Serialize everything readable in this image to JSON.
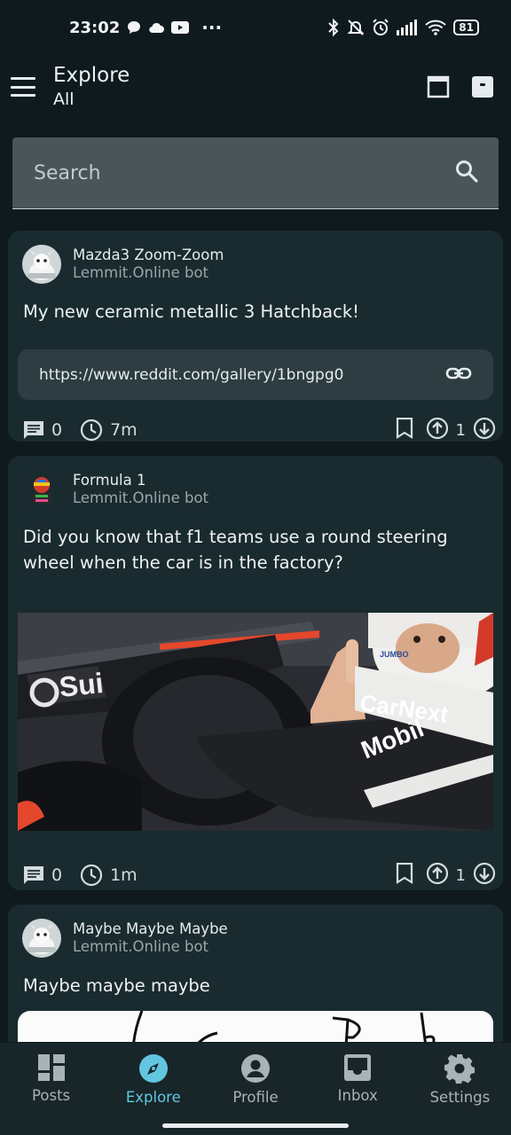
{
  "status": {
    "time": "23:02",
    "battery": "81",
    "more": "···"
  },
  "header": {
    "title": "Explore",
    "subtitle": "All"
  },
  "search": {
    "placeholder": "Search"
  },
  "posts": [
    {
      "community": "Mazda3 Zoom-Zoom",
      "author": "Lemmit.Online bot",
      "title": "My new ceramic metallic 3 Hatchback!",
      "link": "https://www.reddit.com/gallery/1bngpg0",
      "comments": "0",
      "age": "7m",
      "score": "1"
    },
    {
      "community": "Formula 1",
      "author": "Lemmit.Online bot",
      "title": "Did you know that f1 teams use a round steering wheel when the car is in the factory?",
      "comments": "0",
      "age": "1m",
      "score": "1",
      "image_text": {
        "sponsor": "Sui",
        "helmet": "CarNext",
        "side": "Mobil",
        "brand": "JUMBO"
      }
    },
    {
      "community": "Maybe Maybe Maybe",
      "author": "Lemmit.Online bot",
      "title": "Maybe maybe maybe"
    }
  ],
  "nav": [
    {
      "label": "Posts",
      "icon": "posts-icon"
    },
    {
      "label": "Explore",
      "icon": "compass-icon",
      "active": true
    },
    {
      "label": "Profile",
      "icon": "profile-icon"
    },
    {
      "label": "Inbox",
      "icon": "inbox-icon"
    },
    {
      "label": "Settings",
      "icon": "gear-icon"
    }
  ],
  "colors": {
    "accent": "#62c6e0",
    "card": "#1a2b30",
    "background": "#0e1a1e"
  }
}
